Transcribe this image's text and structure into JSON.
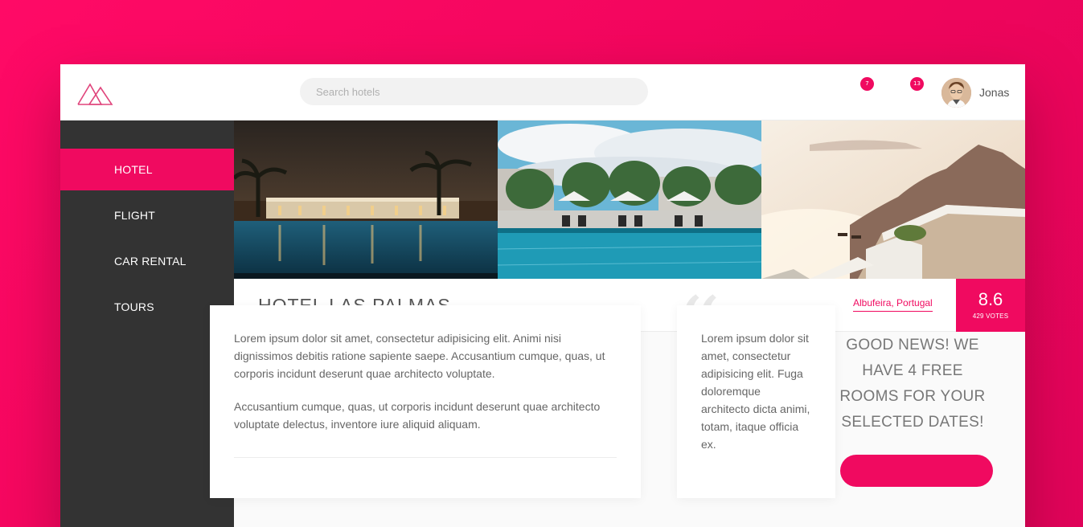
{
  "header": {
    "search_placeholder": "Search hotels",
    "notifications": [
      {
        "icon": "bookmark-icon",
        "count": "7"
      },
      {
        "icon": "chat-icon",
        "count": "13"
      }
    ],
    "user": {
      "name": "Jonas"
    }
  },
  "sidebar": {
    "items": [
      {
        "label": "HOTEL",
        "active": true
      },
      {
        "label": "FLIGHT",
        "active": false
      },
      {
        "label": "CAR RENTAL",
        "active": false
      },
      {
        "label": "TOURS",
        "active": false
      }
    ]
  },
  "hotel": {
    "name": "HOTEL LAS PALMAS",
    "location": "Albufeira, Portugal",
    "rating": {
      "score": "8.6",
      "votes": "429 VOTES"
    }
  },
  "description": {
    "paragraphs": [
      "Lorem ipsum dolor sit amet, consectetur adipisicing elit. Animi nisi dignissimos debitis ratione sapiente saepe. Accusantium cumque, quas, ut corporis incidunt deserunt quae architecto voluptate.",
      "Accusantium cumque, quas, ut corporis incidunt deserunt quae architecto voluptate delectus, inventore iure aliquid aliquam."
    ]
  },
  "review": {
    "text": "Lorem ipsum dolor sit amet, consectetur adipisicing elit. Fuga doloremque architecto dicta animi, totam, itaque officia ex."
  },
  "availability": {
    "message": "GOOD NEWS! WE HAVE 4 FREE ROOMS FOR YOUR SELECTED DATES!"
  },
  "colors": {
    "accent": "#f00a60",
    "sidebar": "#333333",
    "background_gradient_start": "#ff0a66"
  }
}
